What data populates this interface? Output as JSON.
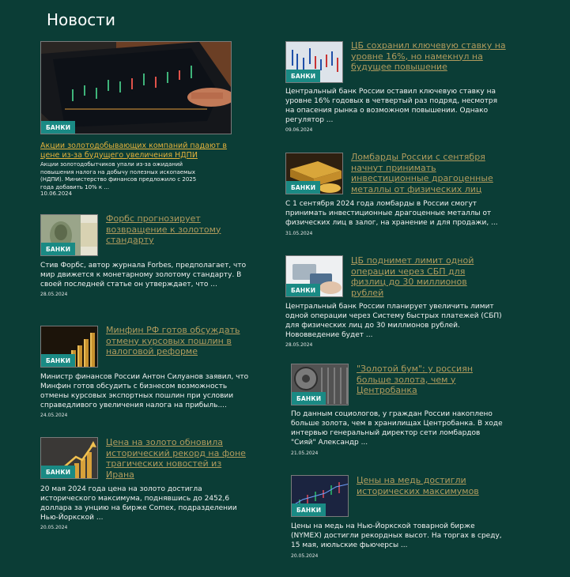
{
  "page": {
    "title": "Новости"
  },
  "badge_label": "БАНКИ",
  "news": [
    {
      "headline": "Акции золотодобывающих компаний падают в цене из-за будущего увеличения НДПИ",
      "excerpt": "Акции золотодобытчиков упали из-за ожиданий повышения налога на добычу полезных ископаемых (НДПИ). Министерство финансов предложило с 2025 года добавить 10% к ...",
      "date": "10.06.2024",
      "image": "tablet-stock-chart"
    },
    {
      "headline": "ЦБ сохранил ключевую ставку на уровне 16%, но намекнул на будущее повышение",
      "excerpt": "Центральный банк России оставил ключевую ставку на уровне 16% годовых в четвертый раз подряд, несмотря на опасения рынка о возможном повышении. Однако регулятор ...",
      "date": "09.06.2024",
      "image": "candlestick-chart"
    },
    {
      "headline": "Форбс прогнозирует возвращение к золотому стандарту",
      "excerpt": "Стив Форбс, автор журнала Forbes, предполагает, что мир движется к монетарному золотому стандарту. В своей последней статье он утверждает, что ...",
      "date": "28.05.2024",
      "image": "dollar-bills"
    },
    {
      "headline": "Ломбарды России с сентября начнут принимать инвестиционные драгоценные металлы от физических лиц",
      "excerpt": "С 1 сентября 2024 года ломбарды в России смогут принимать инвестиционные драгоценные металлы от физических лиц в залог, на хранение и для продажи, ...",
      "date": "31.05.2024",
      "image": "gold-bars-coins"
    },
    {
      "headline": "ЦБ поднимет лимит одной операции через СБП для физлиц до 30 миллионов рублей",
      "excerpt": "Центральный банк России планирует увеличить лимит одной операции через Систему быстрых платежей (СБП) для физических лиц до 30 миллионов рублей. Нововведение будет ...",
      "date": "28.05.2024",
      "image": "card-payment"
    },
    {
      "headline": "Минфин РФ готов обсуждать отмену курсовых пошлин в налоговой реформе",
      "excerpt": "Министр финансов России Антон Силуанов заявил, что Минфин готов обсудить с бизнесом возможность отмены курсовых экспортных пошлин при условии справедливого увеличения налога на прибыль....",
      "date": "24.05.2024",
      "image": "gold-coin-stacks"
    },
    {
      "headline": "\"Золотой бум\": у россиян больше золота, чем у Центробанка",
      "excerpt": "По данным социологов, у граждан России накоплено больше золота, чем в хранилищах Центробанка. В ходе интервью генеральный директор сети ломбардов \"Сияй\" Александр ...",
      "date": "21.05.2024",
      "image": "vault-door"
    },
    {
      "headline": "Цена на золото обновила исторический рекорд на фоне трагических новостей из Ирана",
      "excerpt": "20 мая 2024 года цена на золото достигла исторического максимума, поднявшись до 2452,6 доллара за унцию на бирже Comex, подразделении Нью-Йоркской ...",
      "date": "20.05.2024",
      "image": "gold-growth-arrow"
    },
    {
      "headline": "Цены на медь достигли исторических максимумов",
      "excerpt": "Цены на медь на Нью-Йоркской товарной бирже (NYMEX) достигли рекордных высот. На торгах в среду, 15 мая, июльские фьючерсы ...",
      "date": "20.05.2024",
      "image": "market-chart"
    }
  ]
}
